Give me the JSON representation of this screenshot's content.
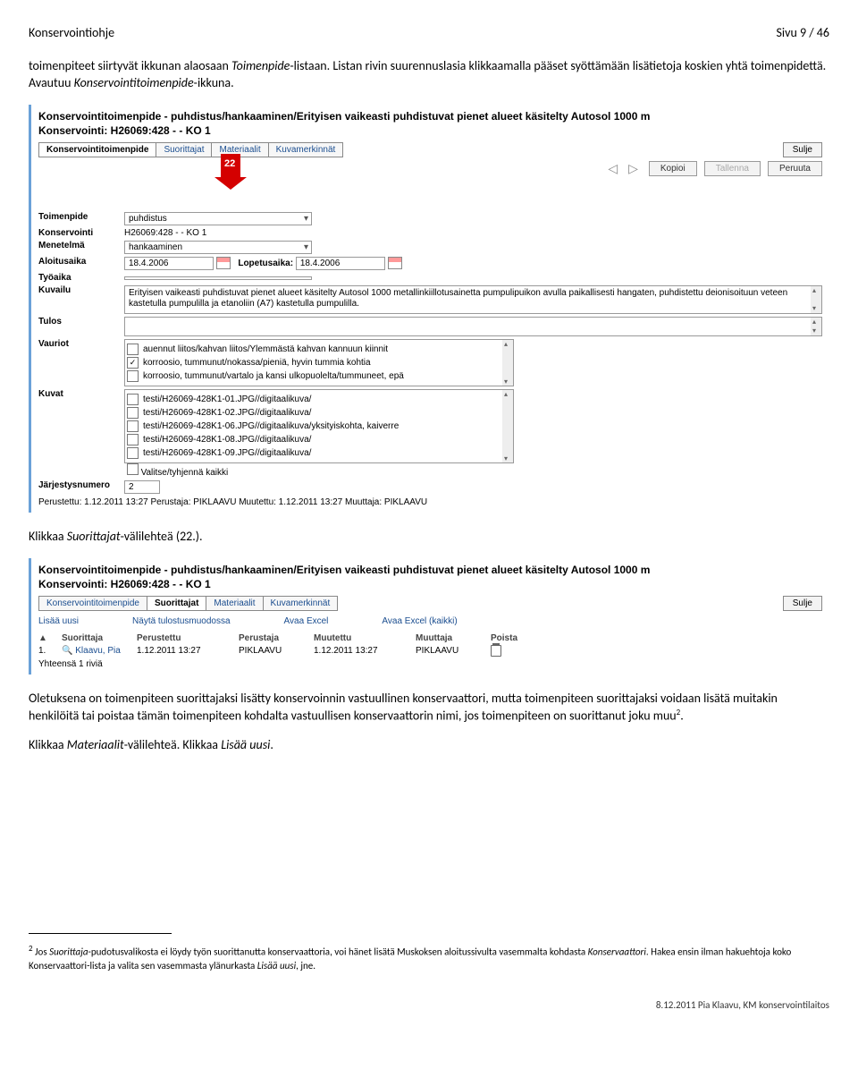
{
  "header": {
    "title": "Konservointiohje",
    "page": "Sivu 9 / 46"
  },
  "para1_a": "toimenpiteet siirtyvät ikkunan alaosaan ",
  "para1_b": "Toimenpide",
  "para1_c": "-listaan. Listan rivin suurennuslasia klikkaamalla pääset syöttämään lisätietoja koskien yhtä toimenpidettä. Avautuu ",
  "para1_d": "Konservointitoimenpide",
  "para1_e": "-ikkuna.",
  "shot1": {
    "title": "Konservointitoimenpide  - puhdistus/hankaaminen/Erityisen vaikeasti puhdistuvat pienet alueet käsitelty Autosol 1000 m",
    "sub": "Konservointi: H26069:428 - - KO 1",
    "tabs": [
      "Konservointitoimenpide",
      "Suorittajat",
      "Materiaalit",
      "Kuvamerkinnät"
    ],
    "sulje": "Sulje",
    "btns": {
      "kopioi": "Kopioi",
      "tallenna": "Tallenna",
      "peruuta": "Peruuta"
    },
    "arrow_num": "22",
    "labels": {
      "toim": "Toimenpide",
      "kons": "Konservointi",
      "mene": "Menetelmä",
      "aloi": "Aloitusaika",
      "lope": "Lopetusaika:",
      "tyo": "Työaika",
      "kuva": "Kuvailu",
      "tulos": "Tulos",
      "vaur": "Vauriot",
      "kuvat": "Kuvat",
      "jarj": "Järjestysnumero"
    },
    "vals": {
      "toim": "puhdistus",
      "kons": "H26069:428 - - KO 1",
      "mene": "hankaaminen",
      "aloi": "18.4.2006",
      "lope": "18.4.2006",
      "kuvailu": "Erityisen vaikeasti puhdistuvat pienet alueet käsitelty Autosol 1000 metallinkiillotusainetta pumpulipuikon avulla paikallisesti hangaten, puhdistettu deionisoituun veteen kastetulla pumpulilla ja etanoliin (A7) kastetulla pumpulilla.",
      "jarj": "2"
    },
    "vauriot": [
      {
        "chk": false,
        "txt": "auennut liitos/kahvan liitos/Ylemmästä kahvan kannuun kiinnit"
      },
      {
        "chk": true,
        "txt": "korroosio, tummunut/nokassa/pieniä, hyvin tummia kohtia"
      },
      {
        "chk": false,
        "txt": "korroosio, tummunut/vartalo ja kansi ulkopuolelta/tummuneet, epä"
      }
    ],
    "kuvat": [
      "testi/H26069-428K1-01.JPG//digitaalikuva/",
      "testi/H26069-428K1-02.JPG//digitaalikuva/",
      "testi/H26069-428K1-06.JPG//digitaalikuva/yksityiskohta, kaiverre",
      "testi/H26069-428K1-08.JPG//digitaalikuva/",
      "testi/H26069-428K1-09.JPG//digitaalikuva/"
    ],
    "valitse": "Valitse/tyhjennä kaikki",
    "audit": "Perustettu: 1.12.2011 13:27 Perustaja: PIKLAAVU Muutettu: 1.12.2011 13:27 Muuttaja: PIKLAAVU"
  },
  "para2_a": "Klikkaa ",
  "para2_b": "Suorittajat",
  "para2_c": "-välilehteä (22.).",
  "shot2": {
    "title": "Konservointitoimenpide  - puhdistus/hankaaminen/Erityisen vaikeasti puhdistuvat pienet alueet käsitelty Autosol 1000 m",
    "sub": "Konservointi: H26069:428 - - KO 1",
    "tabs": [
      "Konservointitoimenpide",
      "Suorittajat",
      "Materiaalit",
      "Kuvamerkinnät"
    ],
    "sulje": "Sulje",
    "links": {
      "lisaa": "Lisää uusi",
      "nayta": "Näytä tulostusmuodossa",
      "excel": "Avaa Excel",
      "excelall": "Avaa Excel (kaikki)"
    },
    "cols": [
      "▲",
      "Suorittaja",
      "Perustettu",
      "Perustaja",
      "Muutettu",
      "Muuttaja",
      "Poista"
    ],
    "row": {
      "n": "1.",
      "mag": "🔍",
      "name": "Klaavu, Pia",
      "per": "1.12.2011 13:27",
      "perj": "PIKLAAVU",
      "muu": "1.12.2011 13:27",
      "muuj": "PIKLAAVU"
    },
    "sum": "Yhteensä 1 riviä"
  },
  "para3": "Oletuksena on toimenpiteen suorittajaksi lisätty konservoinnin vastuullinen konservaattori, mutta toimenpiteen suorittajaksi voidaan lisätä muitakin henkilöitä tai poistaa tämän toimenpiteen kohdalta vastuullisen konservaattorin nimi, jos toimenpiteen on suorittanut joku muu",
  "para3_sup": "2",
  "para3_end": ".",
  "para4_a": "Klikkaa ",
  "para4_b": "Materiaalit",
  "para4_c": "-välilehteä. Klikkaa ",
  "para4_d": "Lisää uusi",
  "para4_e": ".",
  "footnote": {
    "n": "2",
    "a": " Jos ",
    "b": "Suorittaja",
    "c": "-pudotusvalikosta ei löydy työn suorittanutta konservaattoria, voi hänet lisätä Muskoksen aloitussivulta vasemmalta kohdasta ",
    "d": "Konservaattori",
    "e": ". Hakea ensin ilman hakuehtoja koko Konservaattori-lista ja valita sen vasemmasta ylänurkasta ",
    "f": "Lisää uusi",
    "g": ", jne."
  },
  "footer": "8.12.2011 Pia Klaavu, KM konservointilaitos"
}
